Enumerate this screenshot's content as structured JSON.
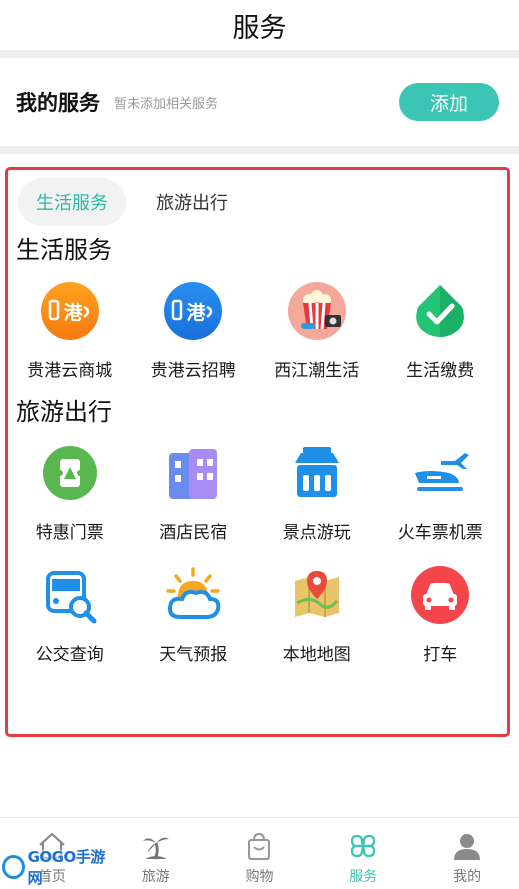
{
  "header": {
    "title": "服务"
  },
  "my_service": {
    "title": "我的服务",
    "hint": "暂未添加相关服务",
    "add_label": "添加"
  },
  "tabs": [
    {
      "label": "生活服务",
      "active": true
    },
    {
      "label": "旅游出行",
      "active": false
    }
  ],
  "sections": {
    "life": {
      "title": "生活服务",
      "items": [
        {
          "label": "贵港云商城",
          "icon": "guigang-cloud-mall-icon"
        },
        {
          "label": "贵港云招聘",
          "icon": "guigang-cloud-recruit-icon"
        },
        {
          "label": "西江潮生活",
          "icon": "popcorn-movie-icon"
        },
        {
          "label": "生活缴费",
          "icon": "check-drop-icon"
        }
      ]
    },
    "travel": {
      "title": "旅游出行",
      "items": [
        {
          "label": "特惠门票",
          "icon": "ticket-icon"
        },
        {
          "label": "酒店民宿",
          "icon": "hotel-icon"
        },
        {
          "label": "景点游玩",
          "icon": "pavilion-icon"
        },
        {
          "label": "火车票机票",
          "icon": "train-plane-icon"
        },
        {
          "label": "公交查询",
          "icon": "bus-search-icon"
        },
        {
          "label": "天气预报",
          "icon": "weather-icon"
        },
        {
          "label": "本地地图",
          "icon": "map-pin-icon"
        },
        {
          "label": "打车",
          "icon": "taxi-icon"
        }
      ]
    }
  },
  "bottom_nav": [
    {
      "label": "首页",
      "icon": "home-icon"
    },
    {
      "label": "旅游",
      "icon": "palm-tree-icon"
    },
    {
      "label": "购物",
      "icon": "shopping-bag-icon"
    },
    {
      "label": "服务",
      "icon": "clover-icon",
      "active": true
    },
    {
      "label": "我的",
      "icon": "user-icon"
    }
  ],
  "watermark": {
    "text": "GOGO手游网"
  },
  "colors": {
    "accent": "#3cc4b4",
    "highlight_border": "#e23d46"
  }
}
